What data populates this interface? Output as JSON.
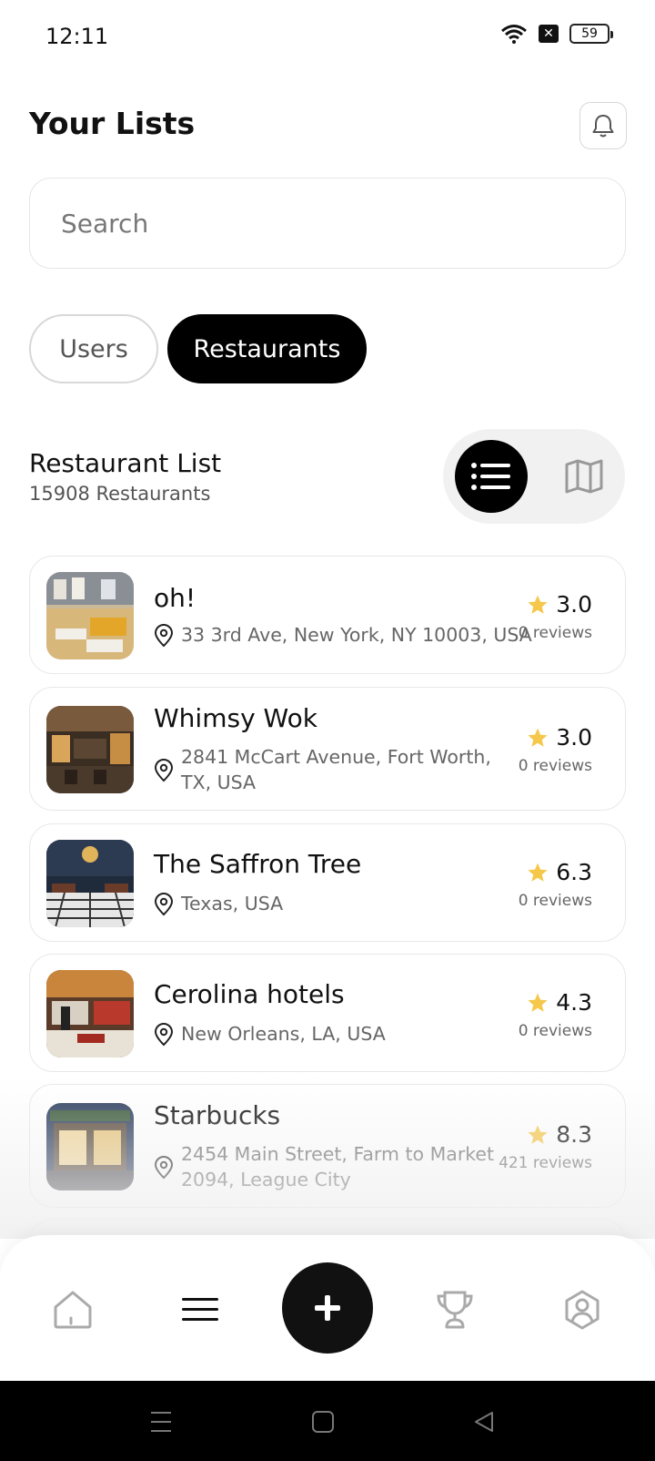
{
  "status_bar": {
    "time": "12:11",
    "battery": "59"
  },
  "header": {
    "title": "Your Lists"
  },
  "search": {
    "placeholder": "Search"
  },
  "tabs": [
    {
      "label": "Users",
      "active": false
    },
    {
      "label": "Restaurants",
      "active": true
    }
  ],
  "list": {
    "title": "Restaurant List",
    "count": "15908 Restaurants",
    "view_mode": "list"
  },
  "restaurants": [
    {
      "name": "oh!",
      "address": "33 3rd Ave, New York, NY 10003, USA",
      "rating": "3.0",
      "reviews": "0 reviews"
    },
    {
      "name": "Whimsy Wok",
      "address": "2841 McCart Avenue, Fort Worth, TX, USA",
      "rating": "3.0",
      "reviews": "0 reviews"
    },
    {
      "name": "The Saffron Tree",
      "address": "Texas, USA",
      "rating": "6.3",
      "reviews": "0 reviews"
    },
    {
      "name": "Cerolina hotels",
      "address": "New Orleans, LA, USA",
      "rating": "4.3",
      "reviews": "0 reviews"
    },
    {
      "name": "Starbucks",
      "address": "2454 Main Street, Farm to Market 2094, League City",
      "rating": "8.3",
      "reviews": "421 reviews"
    }
  ],
  "colors": {
    "star": "#F5C84B",
    "accent": "#000000"
  },
  "nav": {
    "items": [
      "home-icon",
      "menu-icon",
      "add-icon",
      "trophy-icon",
      "profile-icon"
    ],
    "active": "menu-icon"
  }
}
